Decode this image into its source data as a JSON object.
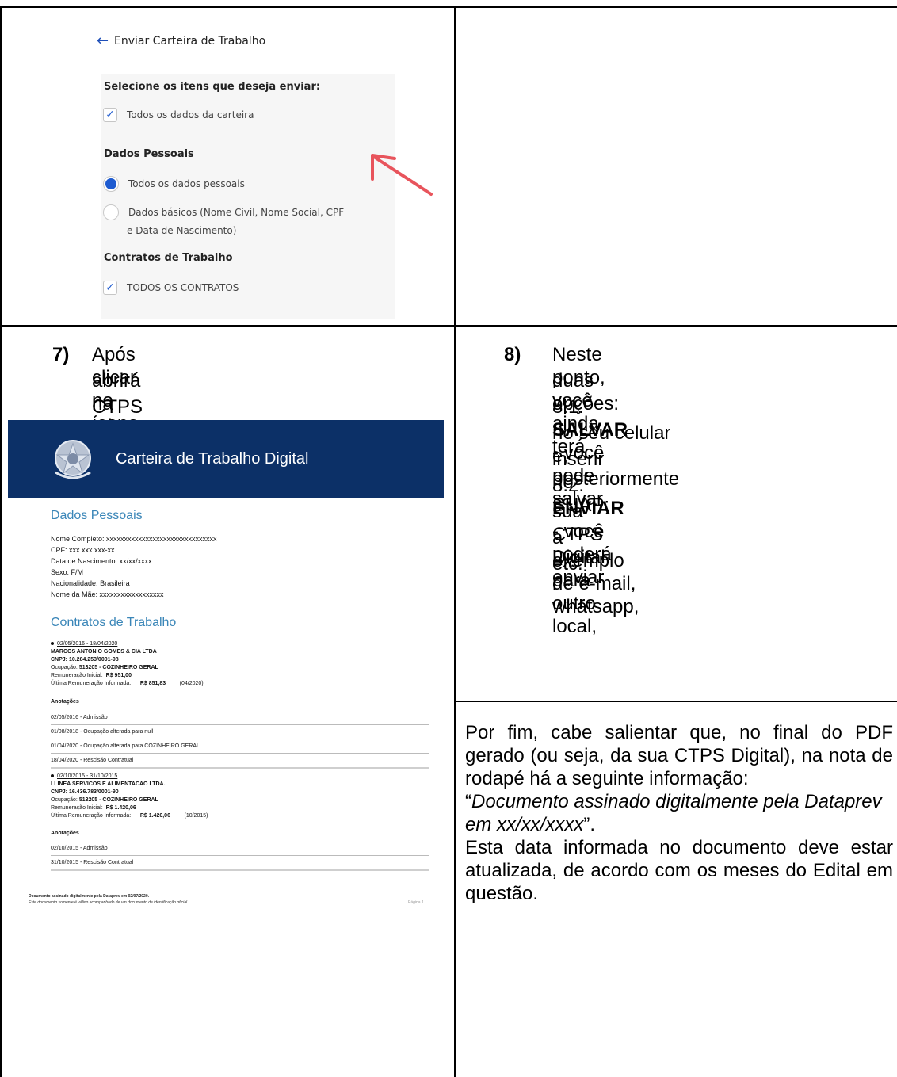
{
  "send_form": {
    "back_icon": "arrow-left-icon",
    "title": "Enviar Carteira de Trabalho",
    "select_prompt": "Selecione os itens que deseja enviar:",
    "all_data_option": "Todos os dados da carteira",
    "all_data_checked": true,
    "personal_section": "Dados Pessoais",
    "personal_all_option": "Todos os dados pessoais",
    "personal_basic_option_line1": "Dados básicos (Nome Civil, Nome Social, CPF",
    "personal_basic_option_line2": "e Data de Nascimento)",
    "personal_selected": "Todos os dados pessoais",
    "contracts_section": "Contratos de Trabalho",
    "contracts_all_option": "TODOS OS CONTRATOS",
    "contracts_all_checked": true,
    "annotation_color": "#e8545c",
    "accent_color": "#1e5bd0"
  },
  "step7": {
    "number": "7)",
    "line1": "Após clicar no ícone do PDF,",
    "line2": "abrirá na tela um PDF com a sua",
    "line3": "CTPS Digital"
  },
  "pdf": {
    "banner_title": "Carteira de Trabalho Digital",
    "banner_color": "#0c3067",
    "personal_heading": "Dados Pessoais",
    "nome_label": "Nome Completo:",
    "nome_value": "xxxxxxxxxxxxxxxxxxxxxxxxxxxxxxx",
    "cpf_label": "CPF:",
    "cpf_value": "xxx.xxx.xxx-xx",
    "nasc_label": "Data de Nascimento:",
    "nasc_value": "xx/xx/xxxx",
    "sexo_label": "Sexo:",
    "sexo_value": "F/M",
    "nac_label": "Nacionalidade:",
    "nac_value": "Brasileira",
    "mae_label": "Nome da Mãe:",
    "mae_value": "xxxxxxxxxxxxxxxxxx",
    "contracts_heading": "Contratos de Trabalho",
    "contracts": [
      {
        "period": "02/05/2016 - 18/04/2020",
        "company": "MARCOS ANTONIO GOMES & CIA LTDA",
        "cnpj": "CNPJ: 10.284.253/0001-98",
        "ocupacao_label": "Ocupação:",
        "ocupacao": "513205 - COZINHEIRO GERAL",
        "rem_inicial_label": "Remuneração Inicial:",
        "rem_inicial": "R$ 951,00",
        "rem_ultima_label": "Última Remuneração Informada:",
        "rem_ultima": "R$ 851,83",
        "rem_ultima_ref": "(04/2020)",
        "anotacoes_label": "Anotações",
        "anotacoes": [
          "02/05/2016 - Admissão",
          "01/08/2018 - Ocupação alterada para null",
          "01/04/2020 - Ocupação alterada para COZINHEIRO GERAL",
          "18/04/2020 - Rescisão Contratual"
        ]
      },
      {
        "period": "02/10/2015 - 31/10/2015",
        "company": "LLINEA SERVICOS E ALIMENTACAO LTDA.",
        "cnpj": "CNPJ: 16.436.783/0001-90",
        "ocupacao_label": "Ocupação:",
        "ocupacao": "513205 - COZINHEIRO GERAL",
        "rem_inicial_label": "Remuneração Inicial:",
        "rem_inicial": "R$ 1.420,06",
        "rem_ultima_label": "Última Remuneração Informada:",
        "rem_ultima": "R$ 1.420,06",
        "rem_ultima_ref": "(10/2015)",
        "anotacoes_label": "Anotações",
        "anotacoes": [
          "02/10/2015 - Admissão",
          "31/10/2015 - Rescisão Contratual"
        ]
      }
    ],
    "footer_line1": "Documento assinado digitalmente pela Dataprev em 02/07/2020.",
    "footer_line2": "Este documento somente é válido acompanhado de um documento de identificação oficial.",
    "page_label": "Página 1"
  },
  "step8": {
    "number": "8)",
    "line1": "Neste ponto, você ainda terá",
    "line2": "duas opções:",
    "opt1_num": "8.1.",
    "opt1_bold": "SALVAR",
    "opt1_rest1": " - você pode salvar",
    "opt1_rest2": "no seu celular e, posteriormente",
    "opt1_rest3": "inserir no SUAP;",
    "opt2_num": "8.2.",
    "opt2_bold": "ENVIAR",
    "opt2_rest1": " - você poderá enviar",
    "opt2_rest2": "sua CTPS Digital para outro local,",
    "opt2_rest3": "a exemplo de e-mail, whatsapp,",
    "opt2_rest4": "etc."
  },
  "final_note": {
    "intro": "Por fim, cabe salientar que, no final do PDF gerado (ou seja, da sua CTPS Digital), na nota de rodapé há a seguinte informação:",
    "quote_open": "“",
    "quote_text": "Documento assinado digitalmente pela Dataprev em xx/xx/xxxx",
    "quote_close": "”.",
    "closing": "Esta data informada no documento deve estar atualizada, de acordo com os meses do Edital em questão."
  }
}
